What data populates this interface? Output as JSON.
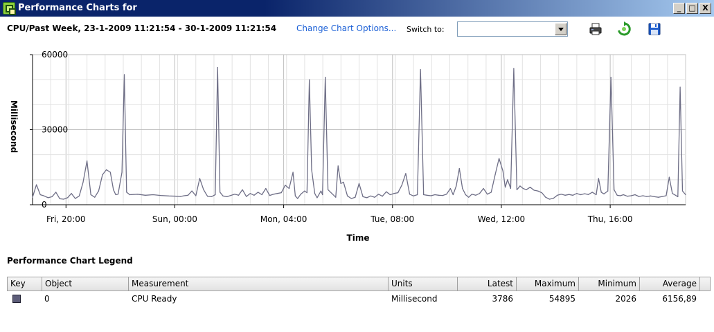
{
  "window": {
    "title": "Performance Charts for",
    "buttons": {
      "minimize": "_",
      "maximize": "□",
      "close": "X"
    }
  },
  "header": {
    "subtitle": "CPU/Past Week, 23-1-2009 11:21:54 - 30-1-2009 11:21:54",
    "change_options_link": "Change Chart Options...",
    "switch_to_label": "Switch to:",
    "switch_to_value": "",
    "icons": [
      "print-icon",
      "refresh-icon",
      "save-icon"
    ]
  },
  "chart_data": {
    "type": "line",
    "title": "",
    "xlabel": "Time",
    "ylabel": "Millisecond",
    "ylim": [
      0,
      60000
    ],
    "yticks": [
      "0",
      "30000",
      "60000"
    ],
    "xlim_hours": [
      0,
      168
    ],
    "x_ticks": [
      {
        "label": "Fri, 20:00",
        "hour": 8.6
      },
      {
        "label": "Sun, 00:00",
        "hour": 36.6
      },
      {
        "label": "Mon, 04:00",
        "hour": 64.6
      },
      {
        "label": "Tue, 08:00",
        "hour": 92.6
      },
      {
        "label": "Wed, 12:00",
        "hour": 120.6
      },
      {
        "label": "Thu, 16:00",
        "hour": 148.6
      }
    ],
    "grid": true,
    "series": [
      {
        "name": "CPU Ready",
        "color": "#6e6e86",
        "points": [
          [
            0,
            3000
          ],
          [
            1,
            8000
          ],
          [
            2,
            4000
          ],
          [
            3,
            3500
          ],
          [
            4,
            2800
          ],
          [
            5,
            3200
          ],
          [
            6,
            5000
          ],
          [
            7,
            2400
          ],
          [
            8,
            2200
          ],
          [
            9,
            2800
          ],
          [
            10,
            4500
          ],
          [
            11,
            2500
          ],
          [
            12,
            3500
          ],
          [
            13,
            9000
          ],
          [
            14,
            17500
          ],
          [
            15,
            4000
          ],
          [
            16,
            3000
          ],
          [
            17,
            5500
          ],
          [
            18,
            12000
          ],
          [
            19,
            14000
          ],
          [
            20,
            13000
          ],
          [
            20.8,
            6000
          ],
          [
            21.4,
            4000
          ],
          [
            22,
            4200
          ],
          [
            23,
            13000
          ],
          [
            23.6,
            52000
          ],
          [
            24.2,
            5000
          ],
          [
            25,
            4000
          ],
          [
            27,
            4200
          ],
          [
            29,
            3800
          ],
          [
            31,
            4000
          ],
          [
            33,
            3700
          ],
          [
            35,
            3500
          ],
          [
            37,
            3400
          ],
          [
            38,
            3300
          ],
          [
            39,
            3600
          ],
          [
            40,
            3800
          ],
          [
            41,
            5500
          ],
          [
            42,
            3600
          ],
          [
            43,
            10500
          ],
          [
            44,
            6000
          ],
          [
            45,
            3400
          ],
          [
            46,
            3200
          ],
          [
            47,
            4000
          ],
          [
            47.6,
            54895
          ],
          [
            48.2,
            5000
          ],
          [
            49,
            3500
          ],
          [
            50,
            3200
          ],
          [
            52,
            4200
          ],
          [
            53,
            3800
          ],
          [
            54,
            6000
          ],
          [
            55,
            3300
          ],
          [
            56,
            4500
          ],
          [
            57,
            3800
          ],
          [
            58,
            5000
          ],
          [
            59,
            4000
          ],
          [
            60,
            6500
          ],
          [
            61,
            3700
          ],
          [
            62,
            4200
          ],
          [
            63,
            4500
          ],
          [
            64,
            4800
          ],
          [
            65,
            7800
          ],
          [
            66,
            6500
          ],
          [
            67,
            13000
          ],
          [
            67.6,
            3500
          ],
          [
            68.2,
            2500
          ],
          [
            69,
            4200
          ],
          [
            70,
            5500
          ],
          [
            70.6,
            4800
          ],
          [
            71.2,
            50000
          ],
          [
            71.8,
            14000
          ],
          [
            72.6,
            4500
          ],
          [
            73.2,
            2800
          ],
          [
            74.2,
            5500
          ],
          [
            74.6,
            4000
          ],
          [
            75.3,
            51000
          ],
          [
            76,
            6000
          ],
          [
            77,
            4500
          ],
          [
            78,
            3000
          ],
          [
            78.6,
            15500
          ],
          [
            79.3,
            8500
          ],
          [
            80,
            9000
          ],
          [
            81,
            3500
          ],
          [
            82,
            2500
          ],
          [
            83,
            3000
          ],
          [
            84,
            8500
          ],
          [
            85,
            3200
          ],
          [
            86,
            2800
          ],
          [
            87,
            3500
          ],
          [
            88,
            3000
          ],
          [
            89,
            4200
          ],
          [
            90,
            3400
          ],
          [
            91,
            5200
          ],
          [
            92,
            4000
          ],
          [
            93,
            4500
          ],
          [
            94,
            4800
          ],
          [
            95,
            7800
          ],
          [
            96,
            12500
          ],
          [
            97,
            4200
          ],
          [
            98,
            3500
          ],
          [
            99,
            4000
          ],
          [
            99.8,
            54000
          ],
          [
            100.6,
            4000
          ],
          [
            101.5,
            3800
          ],
          [
            102.5,
            3600
          ],
          [
            103.5,
            4000
          ],
          [
            104.5,
            3800
          ],
          [
            105.5,
            3700
          ],
          [
            106.5,
            4200
          ],
          [
            107.5,
            6500
          ],
          [
            108.2,
            4000
          ],
          [
            109,
            7500
          ],
          [
            109.8,
            14500
          ],
          [
            110.6,
            6500
          ],
          [
            111.4,
            4000
          ],
          [
            112.2,
            3000
          ],
          [
            113,
            4200
          ],
          [
            114,
            3800
          ],
          [
            115,
            4500
          ],
          [
            116,
            6500
          ],
          [
            117,
            4200
          ],
          [
            118,
            5000
          ],
          [
            119,
            12000
          ],
          [
            120,
            18500
          ],
          [
            121,
            13500
          ],
          [
            121.6,
            7000
          ],
          [
            122.2,
            10000
          ],
          [
            123,
            6500
          ],
          [
            123.8,
            54500
          ],
          [
            124.6,
            6000
          ],
          [
            125.4,
            7500
          ],
          [
            126.2,
            6500
          ],
          [
            127,
            6000
          ],
          [
            128,
            7000
          ],
          [
            129,
            5800
          ],
          [
            130,
            5500
          ],
          [
            131,
            4800
          ],
          [
            132,
            3000
          ],
          [
            133,
            2200
          ],
          [
            134,
            2600
          ],
          [
            135,
            3800
          ],
          [
            136,
            4200
          ],
          [
            137,
            3800
          ],
          [
            138,
            4100
          ],
          [
            139,
            3800
          ],
          [
            140,
            4500
          ],
          [
            141,
            4000
          ],
          [
            142,
            4400
          ],
          [
            143,
            4100
          ],
          [
            144,
            5000
          ],
          [
            145,
            4000
          ],
          [
            145.6,
            10500
          ],
          [
            146.3,
            5000
          ],
          [
            147,
            4300
          ],
          [
            148,
            5500
          ],
          [
            148.8,
            51000
          ],
          [
            149.6,
            6000
          ],
          [
            150.4,
            3800
          ],
          [
            151.2,
            3600
          ],
          [
            152,
            4000
          ],
          [
            153,
            3400
          ],
          [
            154,
            3600
          ],
          [
            155,
            4000
          ],
          [
            156,
            3300
          ],
          [
            157,
            3600
          ],
          [
            158,
            3300
          ],
          [
            159,
            3500
          ],
          [
            160,
            3200
          ],
          [
            161,
            3000
          ],
          [
            162,
            3300
          ],
          [
            163,
            3600
          ],
          [
            163.8,
            11000
          ],
          [
            164.6,
            4500
          ],
          [
            165.4,
            3800
          ],
          [
            166,
            3200
          ],
          [
            166.6,
            47000
          ],
          [
            167.2,
            5500
          ],
          [
            168,
            4000
          ]
        ]
      }
    ]
  },
  "legend": {
    "title": "Performance Chart Legend",
    "columns": [
      "Key",
      "Object",
      "Measurement",
      "Units",
      "Latest",
      "Maximum",
      "Minimum",
      "Average"
    ],
    "rows": [
      {
        "key_color": "#5c5c78",
        "object": "0",
        "measurement": "CPU Ready",
        "units": "Millisecond",
        "latest": "3786",
        "maximum": "54895",
        "minimum": "2026",
        "average": "6156,89"
      }
    ]
  }
}
